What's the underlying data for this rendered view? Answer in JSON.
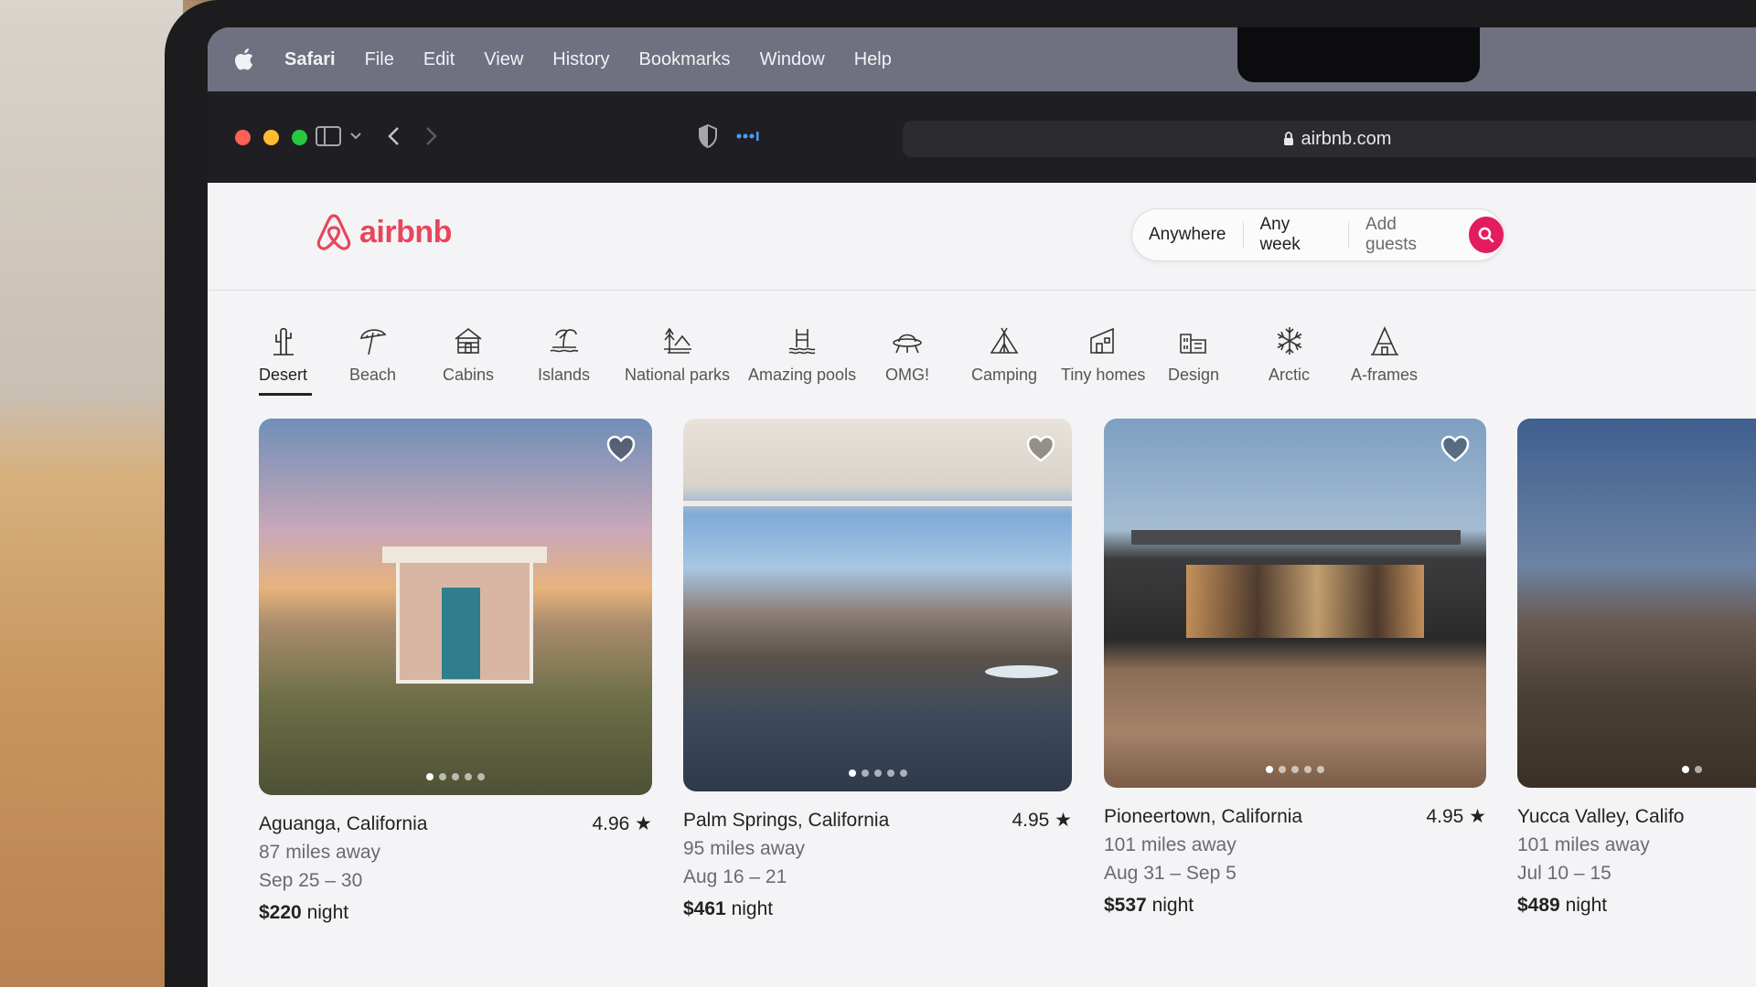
{
  "menubar": {
    "app_name": "Safari",
    "items": [
      "File",
      "Edit",
      "View",
      "History",
      "Bookmarks",
      "Window",
      "Help"
    ]
  },
  "browser": {
    "url": "airbnb.com"
  },
  "site": {
    "logo_text": "airbnb",
    "brand_color": "#e8465a",
    "search": {
      "where": "Anywhere",
      "when": "Any week",
      "guests": "Add guests"
    }
  },
  "categories": [
    {
      "label": "Desert",
      "icon": "desert-icon",
      "active": true
    },
    {
      "label": "Beach",
      "icon": "beach-umbrella-icon"
    },
    {
      "label": "Cabins",
      "icon": "cabin-icon"
    },
    {
      "label": "Islands",
      "icon": "island-icon"
    },
    {
      "label": "National parks",
      "icon": "national-park-icon"
    },
    {
      "label": "Amazing pools",
      "icon": "pool-icon"
    },
    {
      "label": "OMG!",
      "icon": "ufo-icon"
    },
    {
      "label": "Camping",
      "icon": "tent-icon"
    },
    {
      "label": "Tiny homes",
      "icon": "tiny-home-icon"
    },
    {
      "label": "Design",
      "icon": "design-icon"
    },
    {
      "label": "Arctic",
      "icon": "snowflake-icon"
    },
    {
      "label": "A-frames",
      "icon": "a-frame-icon"
    }
  ],
  "listings": [
    {
      "location": "Aguanga, California",
      "rating": "4.96 ★",
      "distance": "87 miles away",
      "dates": "Sep 25 – 30",
      "price": "$220",
      "price_unit": "night"
    },
    {
      "location": "Palm Springs, California",
      "rating": "4.95 ★",
      "distance": "95 miles away",
      "dates": "Aug 16 – 21",
      "price": "$461",
      "price_unit": "night"
    },
    {
      "location": "Pioneertown, California",
      "rating": "4.95 ★",
      "distance": "101 miles away",
      "dates": "Aug 31 – Sep 5",
      "price": "$537",
      "price_unit": "night"
    },
    {
      "location": "Yucca Valley, Califo",
      "rating": "",
      "distance": "101 miles away",
      "dates": "Jul 10 – 15",
      "price": "$489",
      "price_unit": "night"
    }
  ]
}
